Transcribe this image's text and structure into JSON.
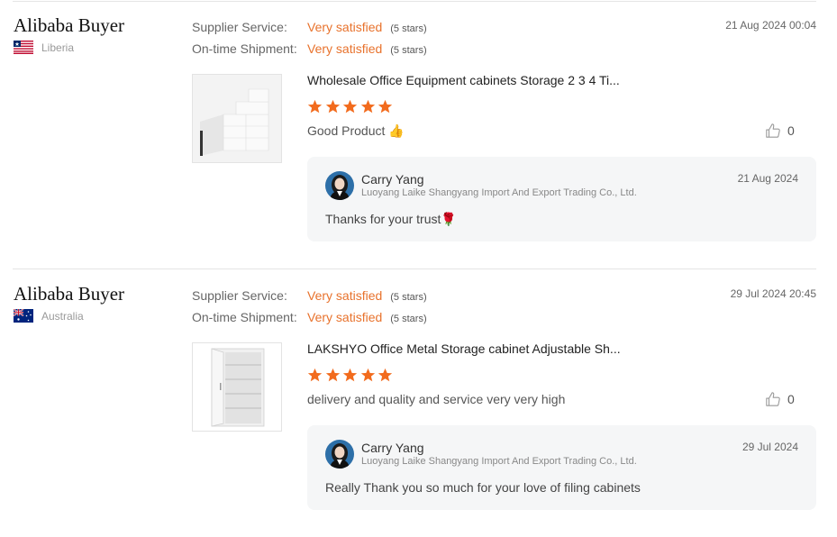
{
  "reviews": [
    {
      "buyer": "Alibaba Buyer",
      "country": "Liberia",
      "flag_icon": "liberia-flag-icon",
      "supplier_service_label": "Supplier Service:",
      "supplier_service_value": "Very satisfied",
      "supplier_service_stars": "(5 stars)",
      "shipment_label": "On-time Shipment:",
      "shipment_value": "Very satisfied",
      "shipment_stars": "(5 stars)",
      "date": "21 Aug 2024 00:04",
      "product_title": "Wholesale Office Equipment cabinets Storage 2 3 4 Ti...",
      "rating": 5,
      "comment": "Good Product 👍",
      "likes": "0",
      "reply": {
        "seller_name": "Carry Yang",
        "company": "Luoyang Laike Shangyang Import And Export Trading Co., Ltd.",
        "date": "21 Aug 2024",
        "text": "Thanks for your trust🌹"
      }
    },
    {
      "buyer": "Alibaba Buyer",
      "country": "Australia",
      "flag_icon": "australia-flag-icon",
      "supplier_service_label": "Supplier Service:",
      "supplier_service_value": "Very satisfied",
      "supplier_service_stars": "(5 stars)",
      "shipment_label": "On-time Shipment:",
      "shipment_value": "Very satisfied",
      "shipment_stars": "(5 stars)",
      "date": "29 Jul 2024 20:45",
      "product_title": "LAKSHYO Office Metal Storage cabinet Adjustable Sh...",
      "rating": 5,
      "comment": "delivery and quality and service very very high",
      "likes": "0",
      "reply": {
        "seller_name": "Carry Yang",
        "company": "Luoyang Laike Shangyang Import And Export Trading Co., Ltd.",
        "date": "29 Jul 2024",
        "text": "Really Thank you so much for your love of filing cabinets"
      }
    }
  ],
  "colors": {
    "accent": "#e8722c",
    "star": "#f26b1d",
    "reply_bg": "#f5f6f7",
    "divider": "#e5e5e5"
  }
}
